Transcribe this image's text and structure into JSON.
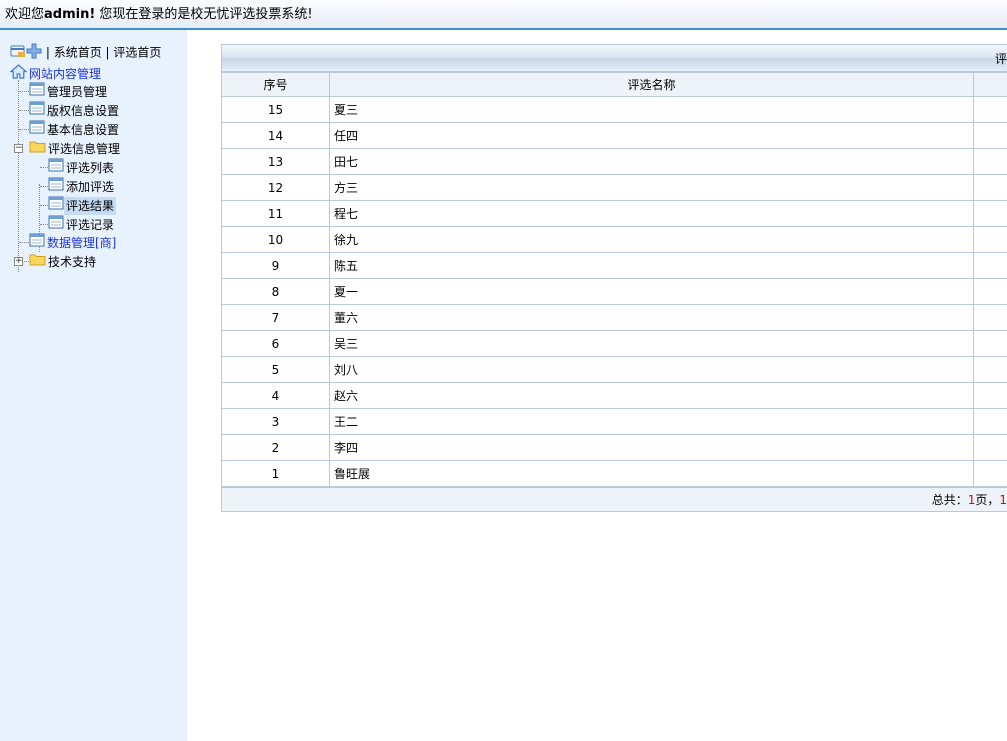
{
  "header": {
    "welcome_prefix": "欢迎您",
    "user": "admin!",
    "welcome_suffix": " 您现在登录的是校无忧评选投票系统!"
  },
  "sidebar": {
    "links": {
      "home": "系统首页",
      "sep1": "|",
      "vote_home": "评选首页",
      "sep0": "|"
    },
    "tree": {
      "root": "网站内容管理",
      "items": [
        "管理员管理",
        "版权信息设置",
        "基本信息设置",
        "评选信息管理",
        "评选列表",
        "添加评选",
        "评选结果",
        "评选记录",
        "数据管理[商]",
        "技术支持"
      ]
    }
  },
  "main": {
    "header_title": "评",
    "columns": [
      "序号",
      "评选名称"
    ],
    "rows": [
      {
        "id": "15",
        "name": "夏三"
      },
      {
        "id": "14",
        "name": "任四"
      },
      {
        "id": "13",
        "name": "田七"
      },
      {
        "id": "12",
        "name": "方三"
      },
      {
        "id": "11",
        "name": "程七"
      },
      {
        "id": "10",
        "name": "徐九"
      },
      {
        "id": "9",
        "name": "陈五"
      },
      {
        "id": "8",
        "name": "夏一"
      },
      {
        "id": "7",
        "name": "董六"
      },
      {
        "id": "6",
        "name": "吴三"
      },
      {
        "id": "5",
        "name": "刘八"
      },
      {
        "id": "4",
        "name": "赵六"
      },
      {
        "id": "3",
        "name": "王二"
      },
      {
        "id": "2",
        "name": "李四"
      },
      {
        "id": "1",
        "name": "鲁旺展"
      }
    ],
    "footer": {
      "total_label": "总共：",
      "pages": "1",
      "page_unit": "页，",
      "next": "1"
    }
  },
  "colors": {
    "accent": "#3f8ed8",
    "sidebar_bg": "#e8f2fd",
    "link_blue": "#1a33e0",
    "border": "#b7c9dc",
    "highlight_red": "#e00000"
  },
  "icons": [
    "card-icon",
    "plus-icon",
    "home-icon",
    "page-icon",
    "folder-icon"
  ]
}
